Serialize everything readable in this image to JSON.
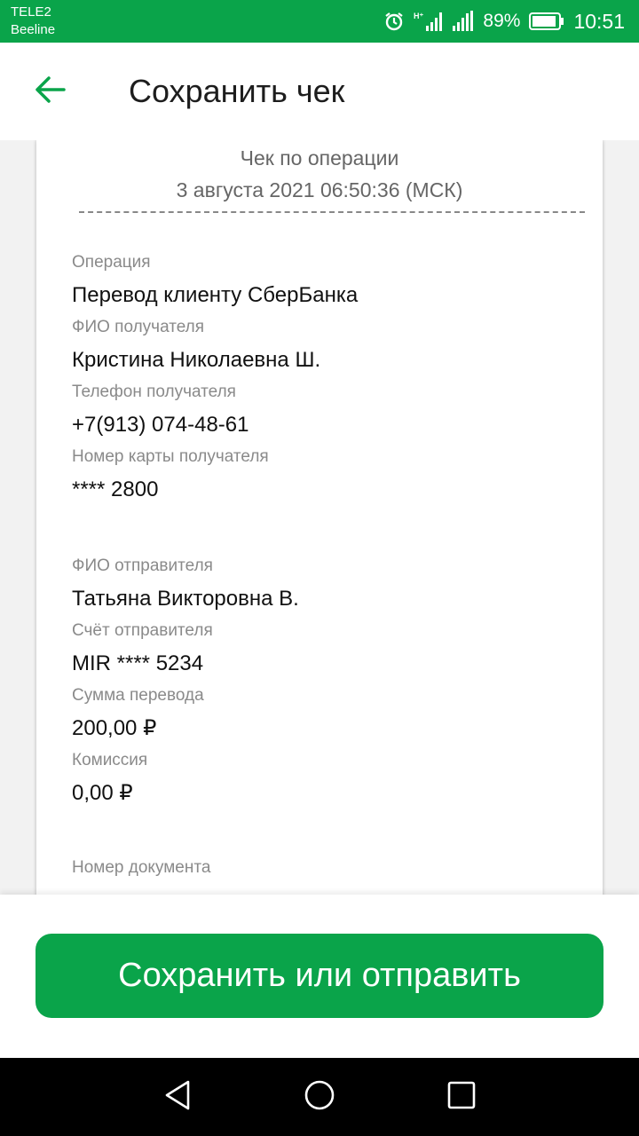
{
  "status_bar": {
    "carrier_1": "TELE2",
    "carrier_2": "Beeline",
    "battery_percent": "89%",
    "time": "10:51",
    "icons": [
      "alarm-icon",
      "signal-h-plus-icon",
      "signal-icon",
      "battery-icon"
    ]
  },
  "header": {
    "title": "Сохранить чек",
    "back_icon": "arrow-left-icon"
  },
  "receipt": {
    "heading": "Чек по операции",
    "datetime": "3 августа 2021 06:50:36 (МСК)",
    "fields": [
      {
        "label": "Операция",
        "value": "Перевод клиенту СберБанка"
      },
      {
        "label": "ФИО получателя",
        "value": "Кристина Николаевна Ш."
      },
      {
        "label": "Телефон получателя",
        "value": "+7(913) 074-48-61"
      },
      {
        "label": "Номер карты получателя",
        "value": "**** 2800"
      },
      {
        "label": "ФИО отправителя",
        "value": "Татьяна Викторовна В."
      },
      {
        "label": "Счёт отправителя",
        "value": "MIR **** 5234"
      },
      {
        "label": "Сумма перевода",
        "value": "200,00 ₽"
      },
      {
        "label": "Комиссия",
        "value": "0,00 ₽"
      },
      {
        "label": "Номер документа",
        "value": ""
      }
    ]
  },
  "action": {
    "button_label": "Сохранить или отправить"
  },
  "navigation": {
    "icons": [
      "back-triangle-icon",
      "home-circle-icon",
      "recents-square-icon"
    ]
  },
  "colors": {
    "brand_green": "#0aa44a",
    "label_gray": "#8a8a8a"
  }
}
